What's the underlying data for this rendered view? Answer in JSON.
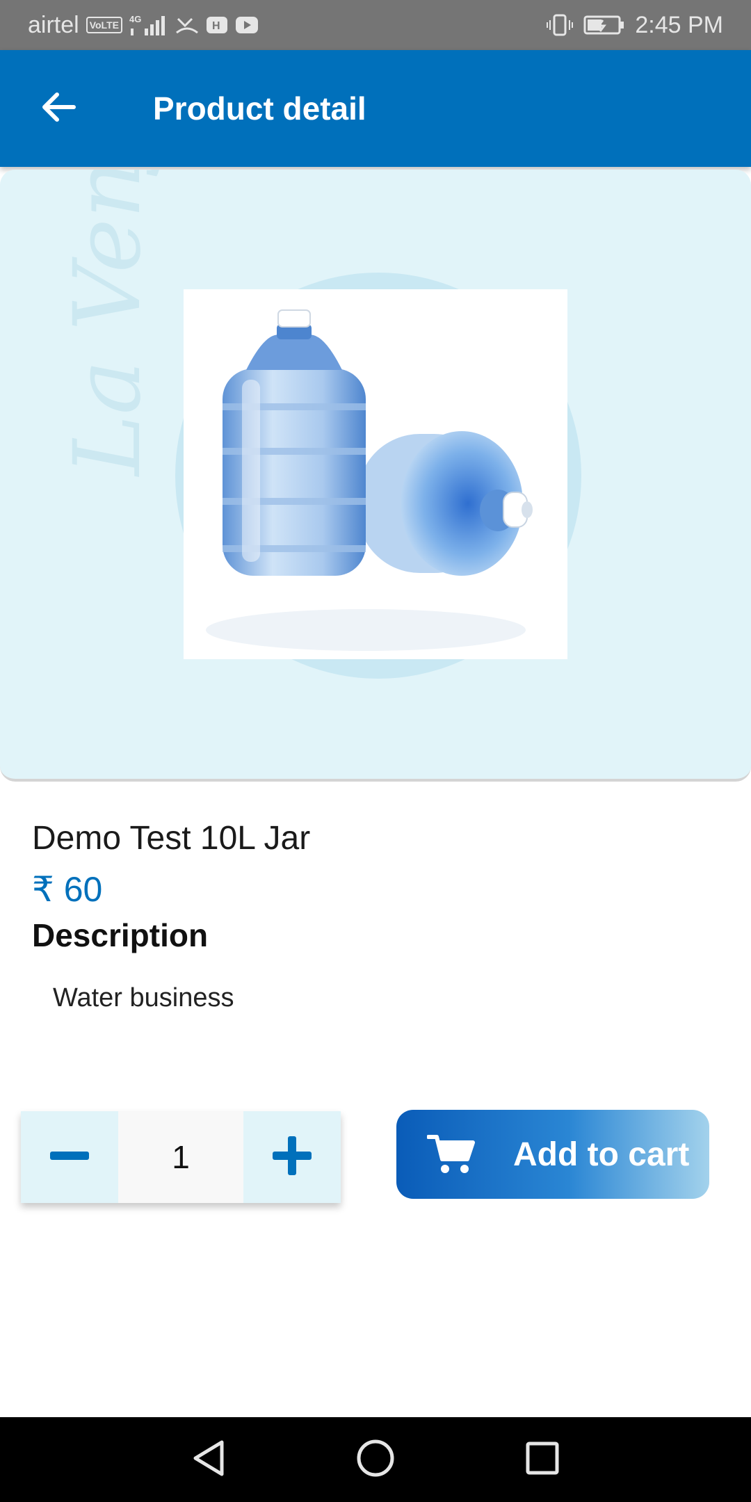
{
  "status_bar": {
    "carrier": "airtel",
    "volte": "VoLTE",
    "network": "4G",
    "time": "2:45 PM"
  },
  "app_bar": {
    "title": "Product detail",
    "back_icon": "arrow-left-icon",
    "color": "#0070bb"
  },
  "hero": {
    "watermark": "La Venjal",
    "image_alt": "Water jars"
  },
  "product": {
    "name": "Demo Test 10L Jar",
    "price": "₹ 60",
    "description_heading": "Description",
    "description": "Water business"
  },
  "quantity": {
    "value": "1",
    "minus_icon": "minus-icon",
    "plus_icon": "plus-icon"
  },
  "cart_button": {
    "label": "Add to cart",
    "icon": "cart-icon"
  },
  "nav": {
    "back_icon": "nav-back-icon",
    "home_icon": "nav-home-icon",
    "recents_icon": "nav-recents-icon"
  },
  "colors": {
    "accent": "#0070bb",
    "hero_bg": "#e1f4f9"
  }
}
